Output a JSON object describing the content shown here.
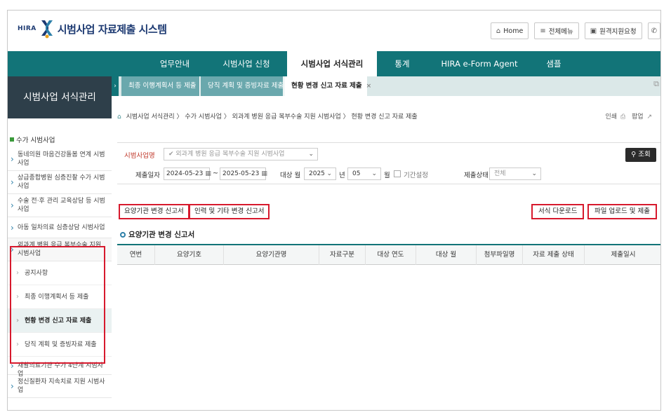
{
  "header": {
    "logo_small": "HIRA",
    "title": "시범사업 자료제출 시스템",
    "buttons": [
      {
        "icon": "home-icon",
        "glyph": "⌂",
        "label": "Home"
      },
      {
        "icon": "menu-icon",
        "glyph": "≡",
        "label": "전체메뉴"
      },
      {
        "icon": "monitor-icon",
        "glyph": "▣",
        "label": "원격지원요청"
      },
      {
        "icon": "phone-icon",
        "glyph": "✆",
        "label": ""
      }
    ]
  },
  "gnb": {
    "items": [
      "업무안내",
      "시범사업 신청",
      "시범사업 서식관리",
      "통계",
      "HIRA e-Form Agent",
      "샘플"
    ],
    "active_index": 2
  },
  "lnb": {
    "title": "시범사업 서식관리",
    "root": "수가 시범사업",
    "items_before": [
      "동네의원 마음건강돌봄 연계 시범사업",
      "상급종합병원 심층진찰 수가 시범사업",
      "수술 전·후 관리 교육상담 등 시범사업",
      "아동 일차의료 심층상담 시범사업"
    ],
    "expanded": {
      "label": "외과계 병원 응급 복부수술 지원 시범사업",
      "children": [
        "공지사항",
        "최종 이행계획서 등 제출",
        "현황 변경 신고 자료 제출",
        "당직 계획 및 증빙자료 제출"
      ],
      "current_index": 2
    },
    "items_after": [
      "재활의료기관 수가 4단계 시범사업",
      "정신질환자 지속치료 지원 시범사업"
    ]
  },
  "tabs": {
    "items": [
      "최종 이행계획서 등 제출",
      "당직 계획 및 증빙자료 제출",
      "현황 변경 신고 자료 제출"
    ],
    "active_index": 2,
    "close_glyph": "×"
  },
  "breadcrumb": {
    "path": "시범사업 서식관리 〉 수가 시범사업 〉 외과계 병원 응급 복부수술 지원 시범사업 〉 현황 변경 신고 자료 제출",
    "print": "인쇄",
    "popup": "팝업"
  },
  "search": {
    "project_label": "시범사업명",
    "project_value": "✔ 외과계 병원 응급 복부수술 지원 시범사업",
    "search_button": "조회",
    "date_label": "제출일자",
    "date_from": "2024-05-23",
    "date_to": "2025-05-23",
    "tilde": "~",
    "month_label": "대상 월",
    "year_value": "2025",
    "year_unit": "년",
    "month_value": "05",
    "month_unit": "월",
    "period_label": "기간설정",
    "status_label": "제출상태",
    "status_value": "전체"
  },
  "content": {
    "subtabs": [
      "요양기관 변경 신고서",
      "인력 및 기타 변경 신고서"
    ],
    "download_button": "서식 다운로드",
    "upload_button": "파일 업로드 및 제출",
    "section_title": "요양기관 변경 신고서",
    "columns": [
      "연번",
      "요양기호",
      "요양기관명",
      "자료구분",
      "대상 연도",
      "대상 월",
      "첨부파일명",
      "자료 제출 상태",
      "제출일시"
    ]
  },
  "colors": {
    "gnb": "#127478",
    "lnb_title": "#2e3f4a",
    "highlight": "#d7192d"
  }
}
